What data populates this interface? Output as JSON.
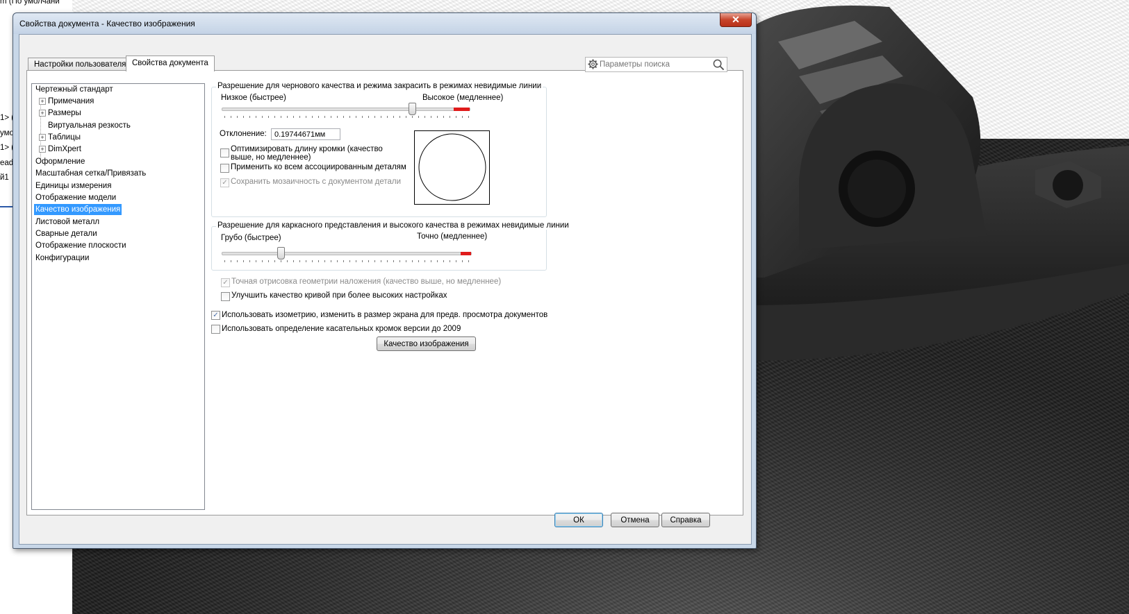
{
  "background": {
    "left_panel_fragments": [
      "m  (По умолчани",
      "1> (",
      "умо",
      "1> (",
      "ead",
      "й1"
    ]
  },
  "dialog": {
    "title": "Свойства документа - Качество изображения",
    "close_glyph": "✕",
    "tabs": [
      {
        "label": "Настройки пользователя"
      },
      {
        "label": "Свойства документа",
        "active": true
      }
    ],
    "search": {
      "placeholder": "Параметры поиска"
    },
    "tree": [
      {
        "label": "Чертежный стандарт",
        "level": 0
      },
      {
        "label": "Примечания",
        "level": 1,
        "expandable": true
      },
      {
        "label": "Размеры",
        "level": 1,
        "expandable": true
      },
      {
        "label": "Виртуальная резкость",
        "level": 1
      },
      {
        "label": "Таблицы",
        "level": 1,
        "expandable": true
      },
      {
        "label": "DimXpert",
        "level": 1,
        "expandable": true
      },
      {
        "label": "Оформление",
        "level": 0
      },
      {
        "label": "Масштабная сетка/Привязать",
        "level": 0
      },
      {
        "label": "Единицы измерения",
        "level": 0
      },
      {
        "label": "Отображение модели",
        "level": 0
      },
      {
        "label": "Качество изображения",
        "level": 0,
        "selected": true
      },
      {
        "label": "Листовой металл",
        "level": 0
      },
      {
        "label": "Сварные детали",
        "level": 0
      },
      {
        "label": "Отображение плоскости",
        "level": 0
      },
      {
        "label": "Конфигурации",
        "level": 0
      }
    ],
    "shaded_group": {
      "title": "Разрешение для чернового качества и режима закрасить в режимах невидимые линии",
      "low_label": "Низкое (быстрее)",
      "high_label": "Высокое (медленнее)",
      "slider_value": 0.77,
      "deviation_label": "Отклонение:",
      "deviation_value": "0.19744671мм",
      "checkboxes": [
        {
          "label_line1": "Оптимизировать длину кромки (качество",
          "label_line2": "выше, но медленнее)",
          "checked": false,
          "enabled": true
        },
        {
          "label": "Применить ко всем ассоциированным деталям",
          "checked": false,
          "enabled": true
        },
        {
          "label": "Сохранить мозаичность с документом детали",
          "checked": true,
          "enabled": false
        }
      ]
    },
    "wireframe_group": {
      "title": "Разрешение для каркасного представления и высокого качества в режимах невидимые линии",
      "low_label": "Грубо (быстрее)",
      "high_label": "Точно (медленнее)",
      "slider_value": 0.24
    },
    "options": [
      {
        "label": "Точная отрисовка геометрии наложения (качество выше, но медленнее)",
        "checked": true,
        "enabled": false
      },
      {
        "label": "Улучшить качество кривой при более высоких настройках",
        "checked": false,
        "enabled": true
      },
      {
        "label": "Использовать изометрию, изменить в размер экрана для предв. просмотра документов",
        "checked": true,
        "enabled": true
      },
      {
        "label": "Использовать определение касательных кромок версии до 2009",
        "checked": false,
        "enabled": true
      }
    ],
    "image_quality_button": "Качество изображения",
    "buttons": {
      "ok": "ОК",
      "cancel": "Отмена",
      "help": "Справка"
    },
    "check_glyph": "✓"
  }
}
